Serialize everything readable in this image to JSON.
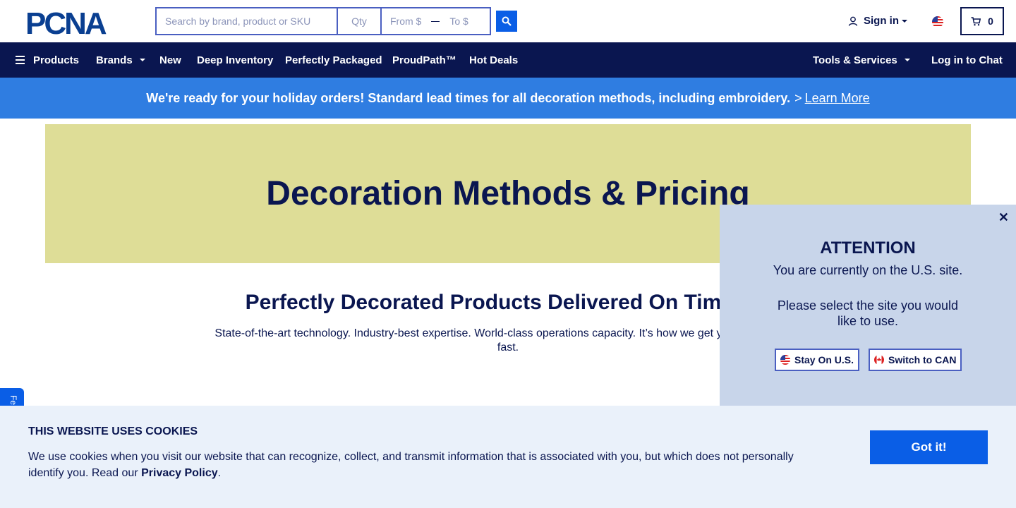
{
  "header": {
    "logo_text": "PCNA",
    "search": {
      "placeholder": "Search by brand, product or SKU",
      "qty_placeholder": "Qty",
      "from_placeholder": "From $",
      "to_placeholder": "To $"
    },
    "signin_label": "Sign in",
    "cart_count": "0"
  },
  "nav": {
    "items": [
      "Products",
      "Brands",
      "New",
      "Deep Inventory",
      "Perfectly Packaged",
      "ProudPath™",
      "Hot Deals",
      "Tools & Services",
      "Log in to Chat"
    ]
  },
  "banner": {
    "text": "We're ready for your holiday orders! Standard lead times for all decoration methods, including embroidery.",
    "arrow": ">",
    "link": "Learn More"
  },
  "hero": {
    "title": "Decoration Methods & Pricing"
  },
  "main": {
    "subhead": "Perfectly Decorated Products Delivered On Time, Ev",
    "subtext_line1": "State-of-the-art technology. Industry-best expertise. World-class operations capacity. It’s how we get your orders deco",
    "subtext_line2": "fast."
  },
  "feedback_tab": "Fe",
  "attention": {
    "close": "✕",
    "title": "ATTENTION",
    "message1": "You are currently on the U.S. site.",
    "message2": "Please select the site you would like to use.",
    "stay_label": "Stay On U.S.",
    "switch_label": "Switch to CAN"
  },
  "cookie": {
    "title": "THIS WEBSITE USES COOKIES",
    "body": "We use cookies when you visit our website that can recognize, collect, and transmit information that is associated with you, but which does not personally identify you. Read our ",
    "policy_link": "Privacy Policy",
    "period": ".",
    "button": "Got it!"
  },
  "colors": {
    "navy": "#0a1650",
    "accent_blue": "#0a5ee6",
    "banner_blue": "#2f7de1",
    "hero_bg": "#dedd97",
    "modal_bg": "#c8d5ea",
    "cookie_bg": "#eaf1fa"
  }
}
